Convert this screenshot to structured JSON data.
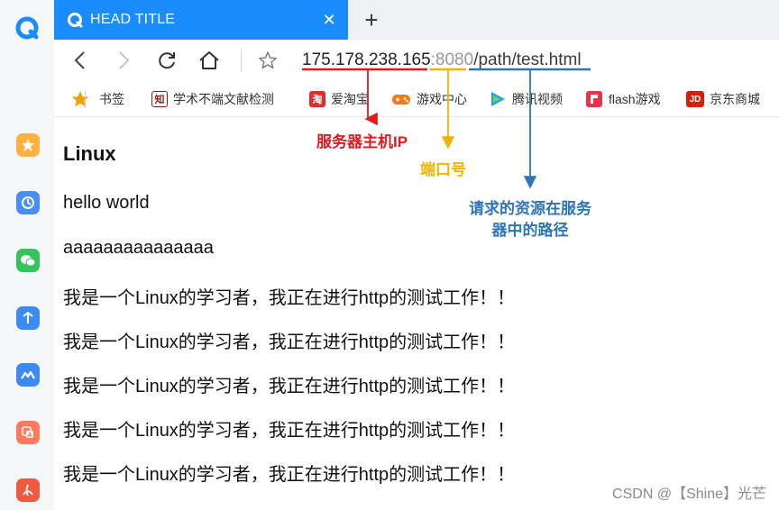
{
  "browser": {
    "tab": {
      "title": "HEAD TITLE",
      "close_glyph": "✕"
    },
    "new_tab_glyph": "+",
    "url": {
      "ip": "175.178.238.165",
      "colon": ":",
      "port": "8080",
      "path": "/path/test.html"
    }
  },
  "bookmarks": [
    {
      "label": "书签",
      "icon": "star-icon",
      "color": "#f5a100"
    },
    {
      "label": "学术不端文献检测",
      "icon": "zhi-icon",
      "color": "#8b1a1a",
      "glyph": "知"
    },
    {
      "label": "爱淘宝",
      "icon": "taobao-icon",
      "color": "#e32b2b",
      "glyph": "淘"
    },
    {
      "label": "游戏中心",
      "icon": "gamepad-icon",
      "color": "#f07b1a"
    },
    {
      "label": "腾讯视频",
      "icon": "play-icon",
      "color": "#1aa5f0"
    },
    {
      "label": "flash游戏",
      "icon": "flash-game-icon",
      "color": "#e8334a"
    },
    {
      "label": "京东商城",
      "icon": "jd-icon",
      "color": "#d81e06",
      "glyph": "JD"
    }
  ],
  "rail_icons": [
    {
      "name": "favorites-icon",
      "color": "#ffb23f"
    },
    {
      "name": "history-icon",
      "color": "#4a8ef5"
    },
    {
      "name": "wechat-icon",
      "color": "#35c45b"
    },
    {
      "name": "transfer-icon",
      "color": "#3d8bf2"
    },
    {
      "name": "cloud-icon",
      "color": "#3d8bf2"
    },
    {
      "name": "translate-icon",
      "color": "#ff7a5c"
    },
    {
      "name": "pdf-icon",
      "color": "#f05a3c"
    }
  ],
  "page": {
    "heading": "Linux",
    "line1": "hello world",
    "line2": "aaaaaaaaaaaaaaa",
    "repeated_line": "我是一个Linux的学习者，我正在进行http的测试工作！！",
    "repeated_count": 5
  },
  "annotations": {
    "ip_label": "服务器主机IP",
    "port_label": "端口号",
    "path_label_line1": "请求的资源在服务",
    "path_label_line2": "器中的路径",
    "colors": {
      "ip": "#e0191f",
      "port": "#f2b400",
      "path": "#2f75b5"
    }
  },
  "watermark": "CSDN @【Shine】光芒"
}
